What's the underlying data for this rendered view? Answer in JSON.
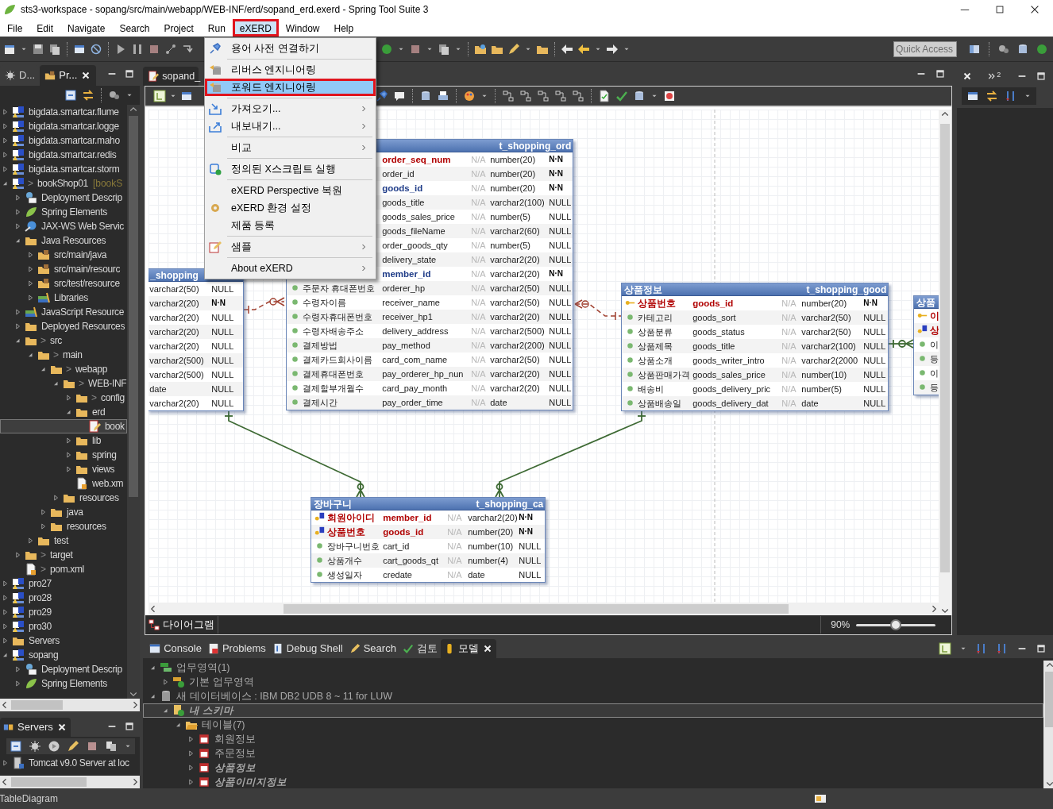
{
  "window": {
    "title": "sts3-workspace - sopang/src/main/webapp/WEB-INF/erd/sopand_erd.exerd - Spring Tool Suite 3"
  },
  "menu_bar": [
    {
      "label": "File",
      "selected": false
    },
    {
      "label": "Edit",
      "selected": false
    },
    {
      "label": "Navigate",
      "selected": false
    },
    {
      "label": "Search",
      "selected": false
    },
    {
      "label": "Project",
      "selected": false
    },
    {
      "label": "Run",
      "selected": false
    },
    {
      "label": "eXERD",
      "selected": true
    },
    {
      "label": "Window",
      "selected": false
    },
    {
      "label": "Help",
      "selected": false
    }
  ],
  "toolbar": {
    "quick_access": {
      "placeholder": "Quick Access"
    }
  },
  "dropdown_menu": [
    {
      "kind": "item",
      "label": "용어 사전 연결하기",
      "submenu": false,
      "selected": false
    },
    {
      "kind": "separator"
    },
    {
      "kind": "item",
      "label": "리버스 엔지니어링",
      "submenu": false,
      "selected": false
    },
    {
      "kind": "item",
      "label": "포워드 엔지니어링",
      "submenu": false,
      "selected": true
    },
    {
      "kind": "separator"
    },
    {
      "kind": "item",
      "label": "가져오기...",
      "submenu": true,
      "selected": false
    },
    {
      "kind": "item",
      "label": "내보내기...",
      "submenu": true,
      "selected": false
    },
    {
      "kind": "separator"
    },
    {
      "kind": "item",
      "label": "비교",
      "submenu": true,
      "selected": false
    },
    {
      "kind": "separator"
    },
    {
      "kind": "item",
      "label": "정의된 X스크립트 실행",
      "submenu": false,
      "selected": false
    },
    {
      "kind": "separator"
    },
    {
      "kind": "item",
      "label": "eXERD Perspective 복원",
      "submenu": false,
      "selected": false
    },
    {
      "kind": "item",
      "label": "eXERD 환경 설정",
      "submenu": false,
      "selected": false
    },
    {
      "kind": "item",
      "label": "제품 등록",
      "submenu": false,
      "selected": false
    },
    {
      "kind": "separator"
    },
    {
      "kind": "item",
      "label": "샘플",
      "submenu": true,
      "selected": false
    },
    {
      "kind": "separator"
    },
    {
      "kind": "item",
      "label": "About eXERD",
      "submenu": true,
      "selected": false
    }
  ],
  "explorer": {
    "tabs": [
      {
        "label": "D...",
        "selected": false,
        "closable": false
      },
      {
        "label": "Pr...",
        "selected": true,
        "closable": true
      }
    ],
    "tree": [
      {
        "label": "bigdata.smartcar.flume",
        "kind": "project",
        "expanded": false,
        "selected": false
      },
      {
        "label": "bigdata.smartcar.logge",
        "kind": "project",
        "expanded": false,
        "selected": false
      },
      {
        "label": "bigdata.smartcar.maho",
        "kind": "project",
        "expanded": false,
        "selected": false
      },
      {
        "label": "bigdata.smartcar.redis",
        "kind": "project",
        "expanded": false,
        "selected": false
      },
      {
        "label": "bigdata.smartcar.storm",
        "kind": "project",
        "expanded": false,
        "selected": false
      },
      {
        "prefix": ">",
        "label": "bookShop01",
        "suffix": "[bookS",
        "kind": "project",
        "expanded": true,
        "selected": false,
        "children": [
          {
            "label": "Deployment Descrip",
            "kind": "descriptor",
            "expanded": false,
            "selected": false
          },
          {
            "label": "Spring Elements",
            "kind": "leaf",
            "expanded": false,
            "selected": false
          },
          {
            "label": "JAX-WS Web Servic",
            "kind": "globe",
            "expanded": false,
            "selected": false
          },
          {
            "label": "Java Resources",
            "kind": "folder",
            "expanded": true,
            "selected": false,
            "children": [
              {
                "label": "src/main/java",
                "kind": "package",
                "expanded": false,
                "selected": false
              },
              {
                "label": "src/main/resourc",
                "kind": "package",
                "expanded": false,
                "selected": false
              },
              {
                "label": "src/test/resource",
                "kind": "package",
                "expanded": false,
                "selected": false
              },
              {
                "label": "Libraries",
                "kind": "books",
                "expanded": false,
                "selected": false
              }
            ]
          },
          {
            "label": "JavaScript Resource",
            "kind": "books",
            "expanded": false,
            "selected": false
          },
          {
            "label": "Deployed Resources",
            "kind": "folder",
            "expanded": false,
            "selected": false
          },
          {
            "prefix": ">",
            "label": "src",
            "kind": "folder",
            "expanded": true,
            "selected": false,
            "children": [
              {
                "prefix": ">",
                "label": "main",
                "kind": "folder",
                "expanded": true,
                "selected": false,
                "children": [
                  {
                    "prefix": ">",
                    "label": "webapp",
                    "kind": "folder",
                    "expanded": true,
                    "selected": false,
                    "children": [
                      {
                        "prefix": ">",
                        "label": "WEB-INF",
                        "kind": "folder",
                        "expanded": true,
                        "selected": false,
                        "children": [
                          {
                            "prefix": ">",
                            "label": "config",
                            "kind": "folder",
                            "expanded": false,
                            "selected": false
                          },
                          {
                            "label": "erd",
                            "kind": "folder",
                            "expanded": true,
                            "selected": false,
                            "children": [
                              {
                                "label": "book",
                                "kind": "erdfile",
                                "selected": true
                              }
                            ]
                          },
                          {
                            "label": "lib",
                            "kind": "folder",
                            "expanded": false,
                            "selected": false
                          },
                          {
                            "label": "spring",
                            "kind": "folder",
                            "expanded": false,
                            "selected": false
                          },
                          {
                            "label": "views",
                            "kind": "folder",
                            "expanded": false,
                            "selected": false
                          },
                          {
                            "label": "web.xm",
                            "kind": "page",
                            "selected": false
                          }
                        ]
                      },
                      {
                        "label": "resources",
                        "kind": "folder",
                        "expanded": false,
                        "selected": false
                      }
                    ]
                  },
                  {
                    "label": "java",
                    "kind": "folder",
                    "expanded": false,
                    "selected": false
                  },
                  {
                    "label": "resources",
                    "kind": "folder",
                    "expanded": false,
                    "selected": false
                  }
                ]
              },
              {
                "label": "test",
                "kind": "folder",
                "expanded": false,
                "selected": false
              }
            ]
          },
          {
            "prefix": ">",
            "label": "target",
            "kind": "folder",
            "expanded": false,
            "selected": false
          },
          {
            "prefix": ">",
            "label": "pom.xml",
            "kind": "page",
            "selected": false
          }
        ]
      },
      {
        "label": "pro27",
        "kind": "project",
        "expanded": false,
        "selected": false
      },
      {
        "label": "pro28",
        "kind": "project",
        "expanded": false,
        "selected": false
      },
      {
        "label": "pro29",
        "kind": "project",
        "expanded": false,
        "selected": false
      },
      {
        "label": "pro30",
        "kind": "project",
        "expanded": false,
        "selected": false
      },
      {
        "label": "Servers",
        "kind": "folder",
        "expanded": false,
        "selected": false
      },
      {
        "label": "sopang",
        "kind": "project",
        "expanded": true,
        "selected": false,
        "children": [
          {
            "label": "Deployment Descrip",
            "kind": "descriptor",
            "expanded": false,
            "selected": false
          },
          {
            "label": "Spring Elements",
            "kind": "leaf",
            "expanded": false,
            "selected": false
          }
        ]
      }
    ]
  },
  "servers": {
    "tab": "Servers",
    "tree": [
      {
        "label": "Tomcat v9.0 Server at loc",
        "kind": "server",
        "expanded": false,
        "selected": false
      }
    ]
  },
  "editor": {
    "tab": "sopand_",
    "diagram_tab": "다이어그램",
    "zoom": {
      "reading": "90%",
      "level": 0.5
    },
    "tables": [
      {
        "logical_title": "_shopping",
        "rows": [
          {
            "kind": "col",
            "type": "varchar2(50)",
            "null": "NULL"
          },
          {
            "kind": "col",
            "type": "varchar2(20)",
            "null": "N·N"
          },
          {
            "kind": "col",
            "type": "varchar2(20)",
            "null": "NULL"
          },
          {
            "kind": "col",
            "type": "varchar2(20)",
            "null": "NULL"
          },
          {
            "kind": "col",
            "type": "varchar2(20)",
            "null": "NULL"
          },
          {
            "kind": "col",
            "type": "varchar2(500)",
            "null": "NULL"
          },
          {
            "kind": "col",
            "type": "varchar2(500)",
            "null": "NULL"
          },
          {
            "kind": "col",
            "type": "date",
            "null": "NULL"
          },
          {
            "kind": "col",
            "type": "varchar2(20)",
            "null": "NULL"
          }
        ]
      },
      {
        "physical_title": "t_shopping_ord",
        "rows": [
          {
            "kind": "pk",
            "physical": "order_seq_num",
            "domain": "N/A",
            "type": "number(20)",
            "null": "N·N"
          },
          {
            "kind": "col",
            "physical": "order_id",
            "domain": "N/A",
            "type": "number(20)",
            "null": "N·N"
          },
          {
            "kind": "fk",
            "physical": "goods_id",
            "domain": "N/A",
            "type": "number(20)",
            "null": "N·N"
          },
          {
            "kind": "col",
            "physical": "goods_title",
            "domain": "N/A",
            "type": "varchar2(100)",
            "null": "NULL"
          },
          {
            "kind": "col",
            "physical": "goods_sales_price",
            "domain": "N/A",
            "type": "number(5)",
            "null": "NULL"
          },
          {
            "kind": "col",
            "physical": "goods_fileName",
            "domain": "N/A",
            "type": "varchar2(60)",
            "null": "NULL"
          },
          {
            "kind": "col",
            "physical": "order_goods_qty",
            "domain": "N/A",
            "type": "number(5)",
            "null": "NULL"
          },
          {
            "kind": "col",
            "physical": "delivery_state",
            "domain": "N/A",
            "type": "varchar2(20)",
            "null": "NULL"
          },
          {
            "kind": "fk",
            "physical": "member_id",
            "domain": "N/A",
            "type": "varchar2(20)",
            "null": "N·N"
          },
          {
            "kind": "col",
            "logical": "주문자 휴대폰번호",
            "physical": "orderer_hp",
            "domain": "N/A",
            "type": "varchar2(50)",
            "null": "NULL"
          },
          {
            "kind": "col",
            "logical": "수령자이름",
            "physical": "receiver_name",
            "domain": "N/A",
            "type": "varchar2(50)",
            "null": "NULL"
          },
          {
            "kind": "col",
            "logical": "수령자휴대폰번호",
            "physical": "receiver_hp1",
            "domain": "N/A",
            "type": "varchar2(20)",
            "null": "NULL"
          },
          {
            "kind": "col",
            "logical": "수령자배송주소",
            "physical": "delivery_address",
            "domain": "N/A",
            "type": "varchar2(500)",
            "null": "NULL"
          },
          {
            "kind": "col",
            "logical": "결제방법",
            "physical": "pay_method",
            "domain": "N/A",
            "type": "varchar2(200)",
            "null": "NULL"
          },
          {
            "kind": "col",
            "logical": "결제카드회사이름",
            "physical": "card_com_name",
            "domain": "N/A",
            "type": "varchar2(50)",
            "null": "NULL"
          },
          {
            "kind": "col",
            "logical": "결제휴대폰번호",
            "physical": "pay_orderer_hp_nun",
            "domain": "N/A",
            "type": "varchar2(20)",
            "null": "NULL"
          },
          {
            "kind": "col",
            "logical": "결제할부개월수",
            "physical": "card_pay_month",
            "domain": "N/A",
            "type": "varchar2(20)",
            "null": "NULL"
          },
          {
            "kind": "col",
            "logical": "결제시간",
            "physical": "pay_order_time",
            "domain": "N/A",
            "type": "date",
            "null": "NULL"
          }
        ]
      },
      {
        "logical_title": "상품정보",
        "physical_title": "t_shopping_good",
        "rows": [
          {
            "kind": "pk",
            "logical": "상품번호",
            "physical": "goods_id",
            "domain": "N/A",
            "type": "number(20)",
            "null": "N·N"
          },
          {
            "kind": "col",
            "logical": "카테고리",
            "physical": "goods_sort",
            "domain": "N/A",
            "type": "varchar2(50)",
            "null": "NULL"
          },
          {
            "kind": "col",
            "logical": "상품분류",
            "physical": "goods_status",
            "domain": "N/A",
            "type": "varchar2(50)",
            "null": "NULL"
          },
          {
            "kind": "col",
            "logical": "상품제목",
            "physical": "goods_title",
            "domain": "N/A",
            "type": "varchar2(100)",
            "null": "NULL"
          },
          {
            "kind": "col",
            "logical": "상품소개",
            "physical": "goods_writer_intro",
            "domain": "N/A",
            "type": "varchar2(2000",
            "null": "NULL"
          },
          {
            "kind": "col",
            "logical": "상품판매가격",
            "physical": "goods_sales_price",
            "domain": "N/A",
            "type": "number(10)",
            "null": "NULL"
          },
          {
            "kind": "col",
            "logical": "배송비",
            "physical": "goods_delivery_pric",
            "domain": "N/A",
            "type": "number(5)",
            "null": "NULL"
          },
          {
            "kind": "col",
            "logical": "상품배송일",
            "physical": "goods_delivery_dat",
            "domain": "N/A",
            "type": "date",
            "null": "NULL"
          }
        ]
      },
      {
        "logical_title": "상품",
        "rows": [
          {
            "kind": "pk",
            "logical": "이"
          },
          {
            "kind": "pfk",
            "logical": "상"
          },
          {
            "kind": "col",
            "logical": "이"
          },
          {
            "kind": "col",
            "logical": "등"
          },
          {
            "kind": "col",
            "logical": "이"
          },
          {
            "kind": "col",
            "logical": "등"
          }
        ]
      },
      {
        "logical_title": "장바구니",
        "physical_title": "t_shopping_ca",
        "rows": [
          {
            "kind": "pfk",
            "logical": "회원아이디",
            "physical": "member_id",
            "domain": "N/A",
            "type": "varchar2(20)",
            "null": "N·N"
          },
          {
            "kind": "pfk",
            "logical": "상품번호",
            "physical": "goods_id",
            "domain": "N/A",
            "type": "number(20)",
            "null": "N·N"
          },
          {
            "kind": "col",
            "logical": "장바구니번호",
            "physical": "cart_id",
            "domain": "N/A",
            "type": "number(10)",
            "null": "NULL"
          },
          {
            "kind": "col",
            "logical": "상품개수",
            "physical": "cart_goods_qt",
            "domain": "N/A",
            "type": "number(4)",
            "null": "NULL"
          },
          {
            "kind": "col",
            "logical": "생성일자",
            "physical": "credate",
            "domain": "N/A",
            "type": "date",
            "null": "NULL"
          }
        ]
      }
    ]
  },
  "right_trim": {
    "overflow_count": "2"
  },
  "bottom_panel": {
    "tabs": [
      {
        "label": "Console",
        "selected": false,
        "closable": false
      },
      {
        "label": "Problems",
        "selected": false,
        "closable": false
      },
      {
        "label": "Debug Shell",
        "selected": false,
        "closable": false
      },
      {
        "label": "Search",
        "selected": false,
        "closable": false
      },
      {
        "label": "검토",
        "selected": false,
        "closable": false
      },
      {
        "label": "모델",
        "selected": true,
        "closable": true
      }
    ],
    "tree": [
      {
        "label": "업무영역(1)",
        "kind": "area",
        "expanded": true,
        "selected": false,
        "emphasis": false,
        "children": [
          {
            "label": "기본 업무영역",
            "kind": "areacheck",
            "expanded": false,
            "selected": false,
            "emphasis": false
          }
        ]
      },
      {
        "label": "새 데이터베이스 : IBM DB2 UDB 8 ~ 11 for LUW",
        "kind": "database",
        "expanded": true,
        "selected": false,
        "emphasis": false,
        "children": [
          {
            "label": "내 스키마",
            "kind": "schema",
            "expanded": true,
            "selected": true,
            "emphasis": true,
            "children": [
              {
                "label": "테이블(7)",
                "kind": "openfolder",
                "expanded": true,
                "selected": false,
                "emphasis": false,
                "children": [
                  {
                    "label": "회원정보",
                    "kind": "table",
                    "expanded": false,
                    "selected": false,
                    "emphasis": false
                  },
                  {
                    "label": "주문정보",
                    "kind": "table",
                    "expanded": false,
                    "selected": false,
                    "emphasis": false
                  },
                  {
                    "label": "상품정보",
                    "kind": "table",
                    "expanded": false,
                    "selected": false,
                    "emphasis": true
                  },
                  {
                    "label": "상품이미지정보",
                    "kind": "table",
                    "expanded": false,
                    "selected": false,
                    "emphasis": true
                  }
                ]
              }
            ]
          }
        ]
      }
    ]
  },
  "status_bar": {
    "text": "TableDiagram"
  }
}
